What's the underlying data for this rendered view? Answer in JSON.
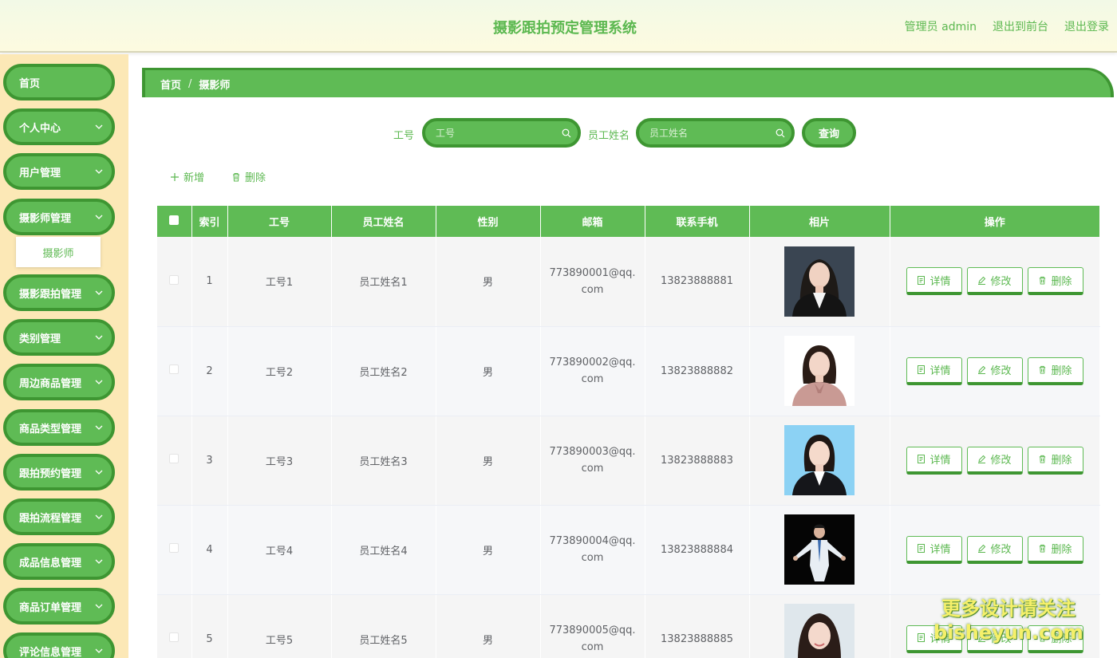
{
  "header": {
    "title": "摄影跟拍预定管理系统",
    "admin_label": "管理员 admin",
    "back_to_front": "退出到前台",
    "logout": "退出登录"
  },
  "sidebar": {
    "items": [
      {
        "label": "首页",
        "has_chevron": false
      },
      {
        "label": "个人中心",
        "has_chevron": true
      },
      {
        "label": "用户管理",
        "has_chevron": true
      },
      {
        "label": "摄影师管理",
        "has_chevron": true,
        "expanded": true
      },
      {
        "label": "摄影跟拍管理",
        "has_chevron": true
      },
      {
        "label": "类别管理",
        "has_chevron": true
      },
      {
        "label": "周边商品管理",
        "has_chevron": true
      },
      {
        "label": "商品类型管理",
        "has_chevron": true
      },
      {
        "label": "跟拍预约管理",
        "has_chevron": true
      },
      {
        "label": "跟拍流程管理",
        "has_chevron": true
      },
      {
        "label": "成品信息管理",
        "has_chevron": true
      },
      {
        "label": "商品订单管理",
        "has_chevron": true
      },
      {
        "label": "评论信息管理",
        "has_chevron": true
      }
    ],
    "subitem": "摄影师"
  },
  "breadcrumb": {
    "home": "首页",
    "separator": "/",
    "current": "摄影师"
  },
  "search": {
    "id_label": "工号",
    "id_placeholder": "工号",
    "name_label": "员工姓名",
    "name_placeholder": "员工姓名",
    "query_button": "查询"
  },
  "actions": {
    "add": "新增",
    "delete": "删除"
  },
  "table": {
    "columns": [
      "索引",
      "工号",
      "员工姓名",
      "性别",
      "邮箱",
      "联系手机",
      "相片",
      "操作"
    ],
    "rows": [
      {
        "index": "1",
        "id": "工号1",
        "name": "员工姓名1",
        "gender": "男",
        "email": "773890001@qq.com",
        "phone": "13823888881"
      },
      {
        "index": "2",
        "id": "工号2",
        "name": "员工姓名2",
        "gender": "男",
        "email": "773890002@qq.com",
        "phone": "13823888882"
      },
      {
        "index": "3",
        "id": "工号3",
        "name": "员工姓名3",
        "gender": "男",
        "email": "773890003@qq.com",
        "phone": "13823888883"
      },
      {
        "index": "4",
        "id": "工号4",
        "name": "员工姓名4",
        "gender": "男",
        "email": "773890004@qq.com",
        "phone": "13823888884"
      },
      {
        "index": "5",
        "id": "工号5",
        "name": "员工姓名5",
        "gender": "男",
        "email": "773890005@qq.com",
        "phone": "13823888885"
      }
    ],
    "row_actions": {
      "detail": "详情",
      "edit": "修改",
      "delete": "删除"
    }
  },
  "watermark": {
    "line1": "更多设计请关注",
    "line2": "bisheyun.com"
  },
  "colors": {
    "primary": "#5fbb55",
    "primary_dark": "#3e9632",
    "sidebar_bg": "#fce8b6"
  }
}
